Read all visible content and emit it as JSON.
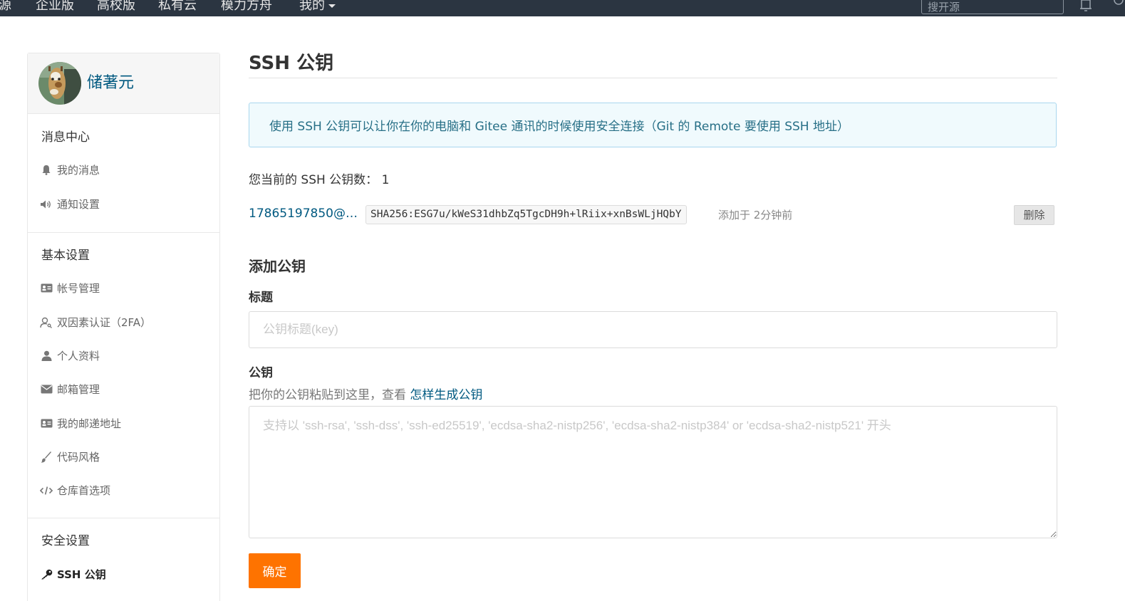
{
  "topnav": {
    "items": [
      "源",
      "企业版",
      "高校版",
      "私有云",
      "模力方舟"
    ],
    "mine_label": "我的",
    "search_placeholder": "搜开源"
  },
  "sidebar": {
    "user_name": "储著元",
    "sections": [
      {
        "title": "消息中心",
        "items": [
          {
            "label": "我的消息",
            "icon": "bell-icon"
          },
          {
            "label": "通知设置",
            "icon": "volume-icon"
          }
        ]
      },
      {
        "title": "基本设置",
        "items": [
          {
            "label": "帐号管理",
            "icon": "id-card-icon"
          },
          {
            "label": "双因素认证（2FA）",
            "icon": "user-key-icon"
          },
          {
            "label": "个人资料",
            "icon": "user-icon"
          },
          {
            "label": "邮箱管理",
            "icon": "envelope-icon"
          },
          {
            "label": "我的邮递地址",
            "icon": "address-card-icon"
          },
          {
            "label": "代码风格",
            "icon": "brush-icon"
          },
          {
            "label": "仓库首选项",
            "icon": "code-icon"
          }
        ]
      },
      {
        "title": "安全设置",
        "items": [
          {
            "label": "SSH 公钥",
            "icon": "key-icon",
            "active": true
          }
        ]
      }
    ]
  },
  "main": {
    "title": "SSH 公钥",
    "info": "使用 SSH 公钥可以让你在你的电脑和 Gitee 通讯的时候使用安全连接（Git 的 Remote 要使用 SSH 地址）",
    "key_count_label": "您当前的 SSH 公钥数：",
    "key_count": "1",
    "keys": [
      {
        "title": "17865197850@…",
        "fingerprint": "SHA256:ESG7u/kWeS31dhbZq5TgcDH9h+lRiix+xnBsWLjHQbY",
        "added": "添加于 2分钟前",
        "delete_label": "删除"
      }
    ],
    "add_title": "添加公钥",
    "title_label": "标题",
    "title_placeholder": "公钥标题(key)",
    "key_label": "公钥",
    "key_hint": "把你的公钥粘贴到这里，查看",
    "key_hint_link": "怎样生成公钥",
    "key_placeholder": "支持以 'ssh-rsa', 'ssh-dss', 'ssh-ed25519', 'ecdsa-sha2-nistp256', 'ecdsa-sha2-nistp384' or 'ecdsa-sha2-nistp521' 开头",
    "submit_label": "确定"
  },
  "colors": {
    "nav_bg": "#2b3541",
    "link": "#005980",
    "accent": "#fe7300",
    "info_bg": "#f0fafd",
    "info_border": "#a9d7ee"
  }
}
